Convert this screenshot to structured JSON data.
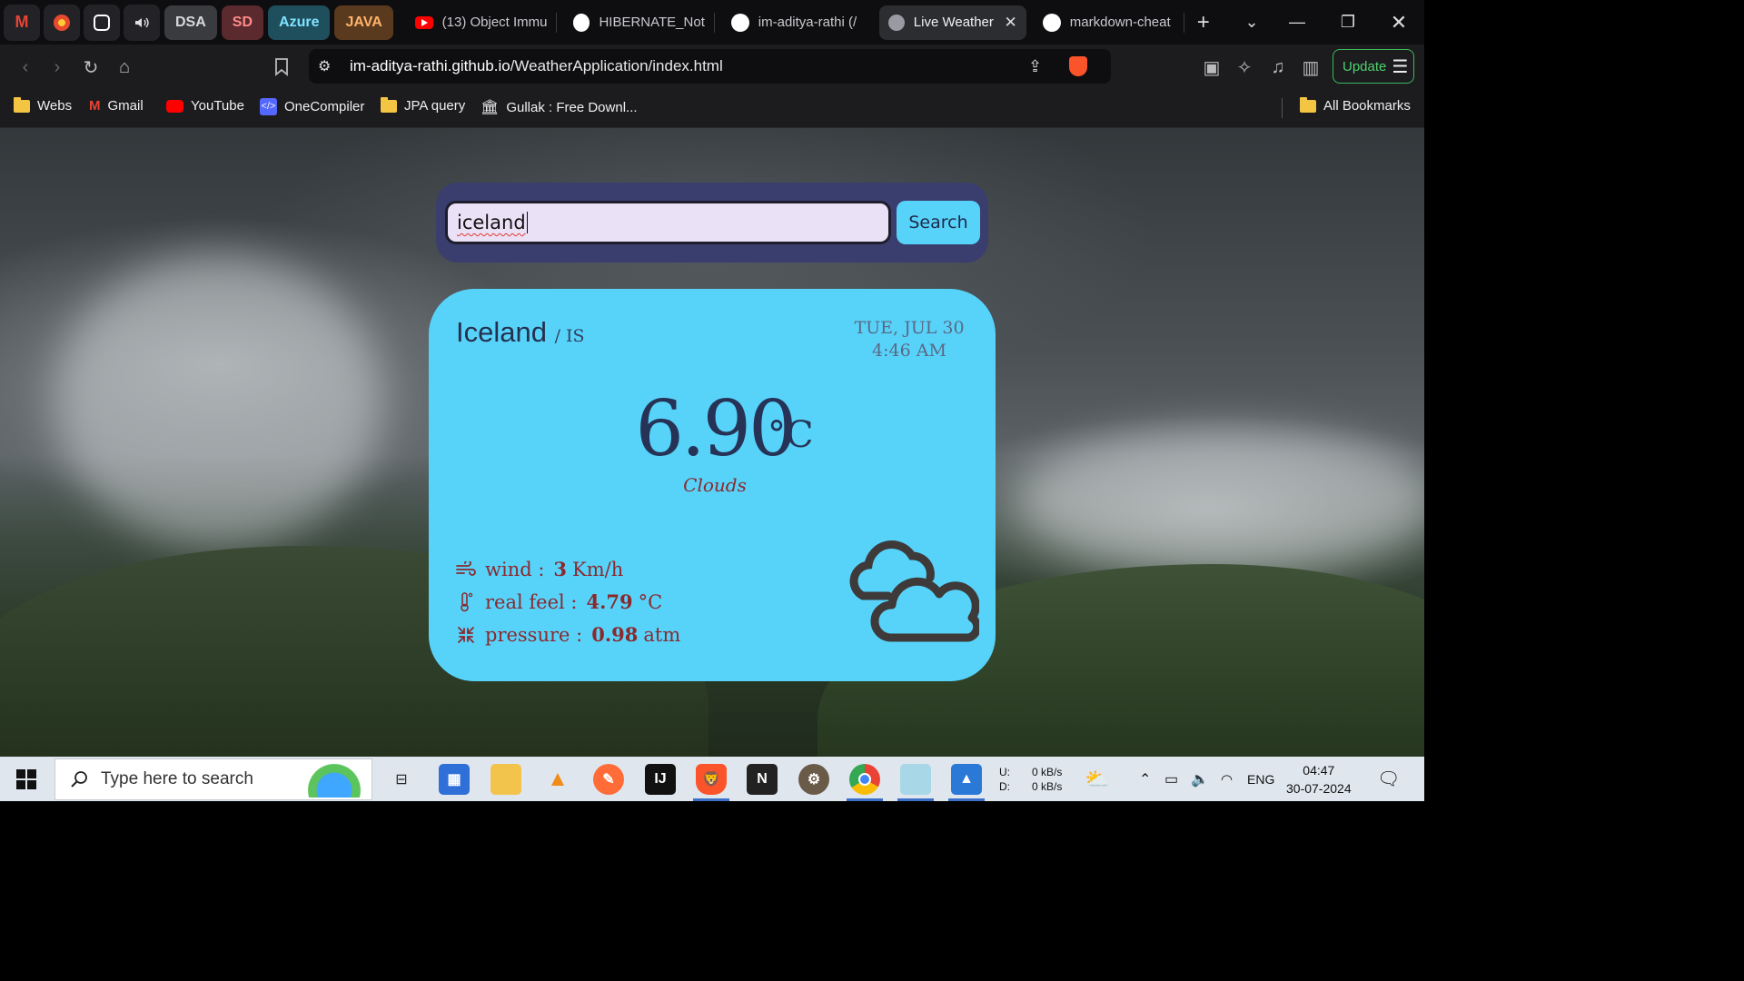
{
  "browser": {
    "pinned_tabs": [
      {
        "name": "gmail",
        "icon": "gmail-icon"
      },
      {
        "name": "circle-app",
        "icon": "red-circle-icon"
      },
      {
        "name": "chatgpt",
        "icon": "openai-icon"
      },
      {
        "name": "audio",
        "icon": "speaker-icon"
      }
    ],
    "groups": [
      "DSA",
      "SD",
      "Azure",
      "JAVA"
    ],
    "tabs": [
      {
        "label": "(13) Object Immu",
        "icon": "youtube-icon"
      },
      {
        "label": "HIBERNATE_Note",
        "icon": "github-icon"
      },
      {
        "label": "im-aditya-rathi (/",
        "icon": "github-icon"
      },
      {
        "label": "Live Weather",
        "icon": "globe-icon",
        "active": true
      },
      {
        "label": "markdown-cheat",
        "icon": "github-icon"
      }
    ],
    "url": {
      "domain": "im-aditya-rathi.github.io",
      "path": "/WeatherApplication/index.html"
    },
    "update_label": "Update",
    "bookmarks": [
      {
        "label": "Webs",
        "icon": "folder-icon"
      },
      {
        "label": "Gmail",
        "icon": "gmail-icon"
      },
      {
        "label": "YouTube",
        "icon": "youtube-icon"
      },
      {
        "label": "OneCompiler",
        "icon": "code-icon"
      },
      {
        "label": "JPA query",
        "icon": "folder-icon"
      },
      {
        "label": "Gullak : Free Downl...",
        "icon": "bank-icon"
      }
    ],
    "all_bookmarks_label": "All Bookmarks"
  },
  "weather_app": {
    "search": {
      "value": "iceland",
      "button": "Search"
    },
    "city": "Iceland",
    "country": "/ IS",
    "date": "TUE, JUL 30",
    "time": "4:46 AM",
    "temperature": "6.90",
    "unit": "°C",
    "condition": "Clouds",
    "stats": {
      "wind_label": "wind :",
      "wind_value": "3",
      "wind_unit": "Km/h",
      "feel_label": "real feel :",
      "feel_value": "4.79",
      "feel_unit": "°C",
      "pressure_label": "pressure :",
      "pressure_value": "0.98",
      "pressure_unit": "atm"
    },
    "colors": {
      "card": "#57d3fa",
      "search_panel": "#3a3e6e",
      "accent_text": "#8a2a2e",
      "heading": "#263356"
    }
  },
  "taskbar": {
    "search_placeholder": "Type here to search",
    "network": {
      "up_label": "U:",
      "down_label": "D:",
      "up_value": "0 kB/s",
      "down_value": "0 kB/s"
    },
    "language": "ENG",
    "time": "04:47",
    "date": "30-07-2024"
  }
}
